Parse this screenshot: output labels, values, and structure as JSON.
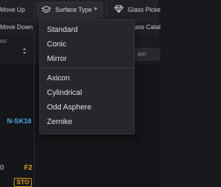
{
  "toolbar": {
    "move_up_label": "Move Up",
    "surface_type_label": "Surface Type",
    "glass_picker_label": "Glass Picke",
    "move_down_label": "Move Down",
    "glass_catalog_label": "Glass Catal"
  },
  "table": {
    "col_fragment": "es",
    "item_chip": "em",
    "glass_value": "N-SK16",
    "row_value": "0",
    "f_badge": "F2",
    "stop_badge": "STO"
  },
  "colors": {
    "glass_blue": "#4aa8e6",
    "accent_orange": "#e0a020"
  },
  "surface_type_menu": {
    "group1": [
      "Standard",
      "Conic",
      "Mirror"
    ],
    "group2": [
      "Axicon",
      "Cylindrical",
      "Odd Asphere",
      "Zernike"
    ]
  }
}
